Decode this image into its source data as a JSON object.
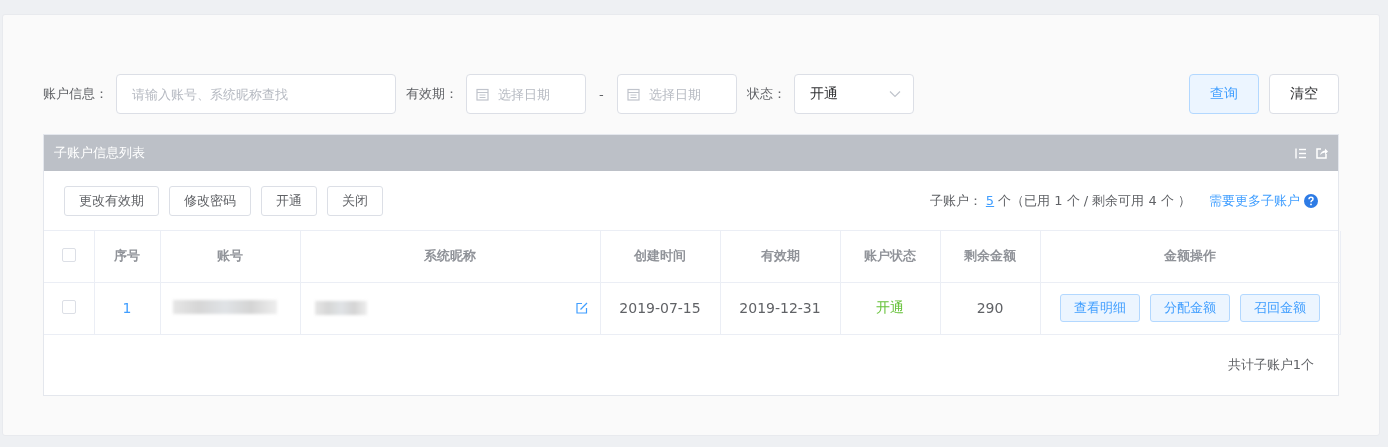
{
  "filters": {
    "account_label": "账户信息：",
    "account_placeholder": "请输入账号、系统昵称查找",
    "validity_label": "有效期：",
    "start_placeholder": "选择日期",
    "range_separator": "-",
    "end_placeholder": "选择日期",
    "status_label": "状态：",
    "status_value": "开通",
    "buttons": [
      {
        "label": "查询",
        "kind": "primary"
      },
      {
        "label": "清空",
        "kind": "plain"
      }
    ]
  },
  "panel": {
    "title": "子账户信息列表",
    "actions": [
      "更改有效期",
      "修改密码",
      "开通",
      "关闭"
    ],
    "summary": {
      "label": "子账户：",
      "count": "5",
      "detail": "个（已用 1 个 / 剩余可用 4 个 ）",
      "link": "需要更多子账户"
    },
    "table": {
      "select_all_checked": false,
      "columns": [
        "序号",
        "账号",
        "系统昵称",
        "创建时间",
        "有效期",
        "账户状态",
        "剩余金额",
        "金额操作"
      ],
      "rows": [
        {
          "selected": false,
          "index": "1",
          "created": "2019-07-15",
          "expires": "2019-12-31",
          "status": {
            "text": "开通",
            "color": "#67c23a"
          },
          "balance": "290",
          "operations": [
            "查看明细",
            "分配金额",
            "召回金额"
          ]
        }
      ]
    },
    "footer": "共计子账户1个"
  }
}
